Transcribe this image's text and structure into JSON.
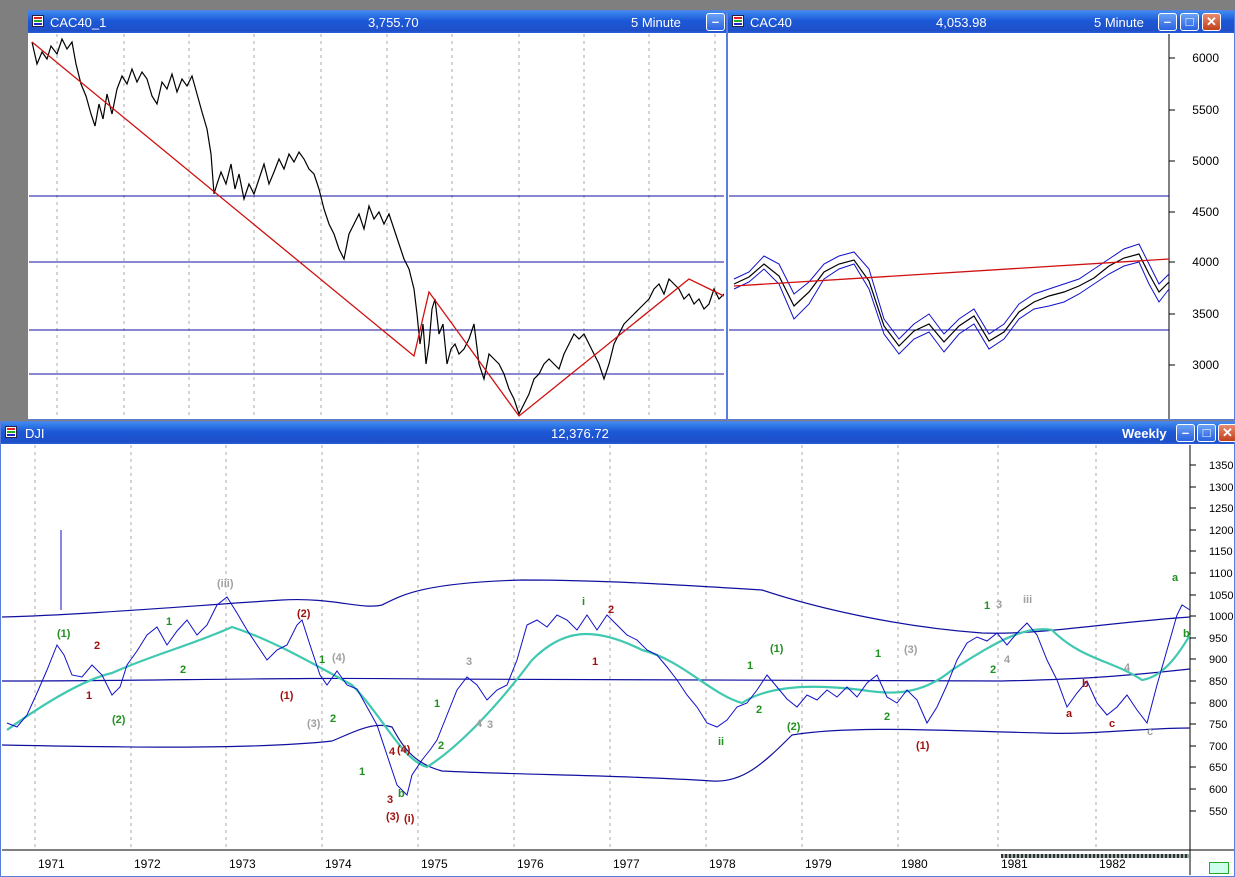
{
  "windows": {
    "cac40_1": {
      "title": "CAC40_1",
      "price": "3,755.70",
      "interval": "5 Minute"
    },
    "cac40": {
      "title": "CAC40",
      "price": "4,053.98",
      "interval": "5 Minute",
      "y_ticks": [
        "6000",
        "5500",
        "5000",
        "4500",
        "4000",
        "3500",
        "3000"
      ]
    },
    "dji": {
      "title": "DJI",
      "price": "12,376.72",
      "interval": "Weekly",
      "y_ticks": [
        "1350",
        "1300",
        "1250",
        "1200",
        "1150",
        "1100",
        "1050",
        "1000",
        "950",
        "900",
        "850",
        "800",
        "750",
        "700",
        "650",
        "600",
        "550"
      ],
      "x_ticks": [
        "1971",
        "1972",
        "1973",
        "1974",
        "1975",
        "1976",
        "1977",
        "1978",
        "1979",
        "1980",
        "1981",
        "1982"
      ]
    }
  },
  "wave_labels": {
    "green": [
      "(1)",
      "1",
      "2",
      "i",
      "1",
      "(1)",
      "2",
      "(2)",
      "1",
      "2",
      "1",
      "2",
      "ii",
      "a",
      "b",
      "1",
      "2",
      "1",
      "2",
      "1",
      "b",
      "(2)"
    ],
    "darkred": [
      "(2)",
      "2",
      "1",
      "(1)",
      "(3)",
      "(i)",
      "1",
      "2",
      "3",
      "(1)",
      "a",
      "c",
      "b"
    ],
    "gray": [
      "(iii)",
      "(4)",
      "(3)",
      "3",
      "4",
      "3",
      "(3)",
      "3",
      "4",
      "iii",
      "4",
      "c"
    ],
    "mixed": [
      "4",
      "(4)"
    ]
  },
  "colors": {
    "price": "#000000",
    "trend": "#d01010",
    "band": "#1010a0",
    "ma": "#40c8b0",
    "up": "#1010c8",
    "down": "#c01010",
    "neutral": "#20a020"
  }
}
